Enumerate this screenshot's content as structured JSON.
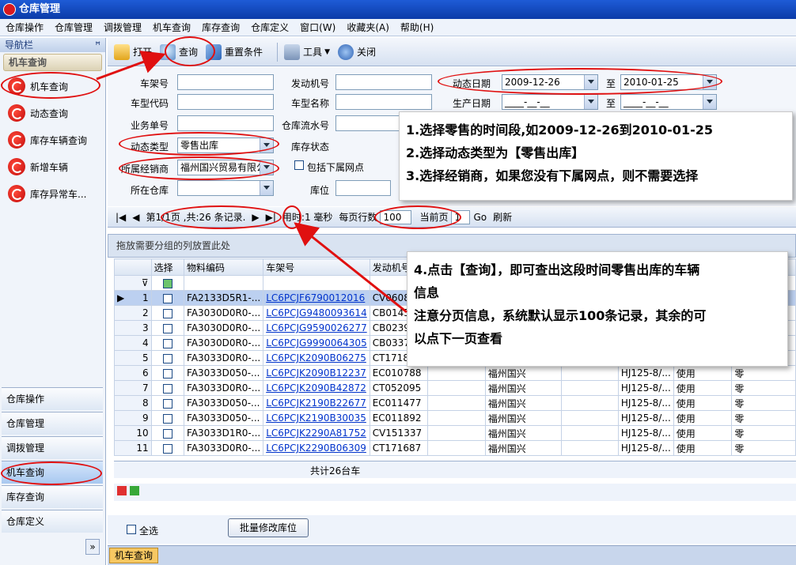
{
  "app": {
    "title": "仓库管理"
  },
  "menu": [
    "仓库操作",
    "仓库管理",
    "调拨管理",
    "机车查询",
    "库存查询",
    "仓库定义",
    "窗口(W)",
    "收藏夹(A)",
    "帮助(H)"
  ],
  "nav": {
    "header": "导航栏",
    "pin": "ꟸ",
    "group": "机车查询",
    "items": [
      "机车查询",
      "动态查询",
      "库存车辆查询",
      "新增车辆",
      "库存异常车..."
    ],
    "bottom": [
      "仓库操作",
      "仓库管理",
      "调拨管理",
      "机车查询",
      "库存查询",
      "仓库定义"
    ],
    "more": "»"
  },
  "toolbar": {
    "open": "打开",
    "query": "查询",
    "reset": "重置条件",
    "tools": "工具",
    "close": "关闭"
  },
  "form": {
    "frame_no": {
      "label": "车架号",
      "value": ""
    },
    "engine_no": {
      "label": "发动机号",
      "value": ""
    },
    "model_code": {
      "label": "车型代码",
      "value": ""
    },
    "model_name": {
      "label": "车型名称",
      "value": ""
    },
    "biz_no": {
      "label": "业务单号",
      "value": ""
    },
    "serial_no": {
      "label": "仓库流水号",
      "value": ""
    },
    "dyn_type": {
      "label": "动态类型",
      "value": "零售出库"
    },
    "stock_status": {
      "label": "库存状态"
    },
    "dealer": {
      "label": "所属经销商",
      "value": "福州国兴贸易有限公"
    },
    "include_sub": "包括下属网点",
    "warehouse": {
      "label": "所在仓库",
      "value": ""
    },
    "location": {
      "label": "库位",
      "value": ""
    },
    "dyn_date": {
      "label": "动态日期",
      "from": "2009-12-26",
      "to_label": "至",
      "to": "2010-01-25"
    },
    "prod_date": {
      "label": "生产日期",
      "from": "____-__-__",
      "to_label": "至",
      "to": "____-__-__"
    }
  },
  "pager": {
    "page_info": "第1/1页 ,共:26 条记录.",
    "time": "用时:1 毫秒",
    "rows_label": "每页行数",
    "rows": "100",
    "cur_label": "当前页",
    "cur": "1",
    "go": "Go",
    "refresh": "刷新"
  },
  "grid": {
    "group_hint": "拖放需要分组的列放置此处",
    "headers": [
      "选择",
      "物料编码",
      "车架号",
      "发动机号"
    ],
    "rows": [
      [
        "1",
        "FA2133D5R1-...",
        "LC6PCJF6790012016",
        "CV060834",
        "",
        "",
        "",
        "",
        "",
        ""
      ],
      [
        "2",
        "FA3030D0R0-...",
        "LC6PCJG9480093614",
        "CB014571",
        "",
        "",
        "",
        "",
        "",
        ""
      ],
      [
        "3",
        "FA3030D0R0-...",
        "LC6PCJG9590026277",
        "CB023963",
        "",
        "",
        "",
        "",
        "",
        ""
      ],
      [
        "4",
        "FA3030D0R0-...",
        "LC6PCJG9990064305",
        "CB033728",
        "",
        "",
        "",
        "",
        "",
        ""
      ],
      [
        "5",
        "FA3033D0R0-...",
        "LC6PCJK2090B06275",
        "CT171847",
        "",
        "",
        "",
        "",
        "",
        ""
      ],
      [
        "6",
        "FA3033D050-...",
        "LC6PCJK2090B12237",
        "EC010788",
        "",
        "福州国兴",
        "",
        "HJ125-8/...",
        "使用",
        "零"
      ],
      [
        "7",
        "FA3033D0R0-...",
        "LC6PCJK2090B42872",
        "CT052095",
        "",
        "福州国兴",
        "",
        "HJ125-8/...",
        "使用",
        "零"
      ],
      [
        "8",
        "FA3033D050-...",
        "LC6PCJK2190B22677",
        "EC011477",
        "",
        "福州国兴",
        "",
        "HJ125-8/...",
        "使用",
        "零"
      ],
      [
        "9",
        "FA3033D050-...",
        "LC6PCJK2190B30035",
        "EC011892",
        "",
        "福州国兴",
        "",
        "HJ125-8/...",
        "使用",
        "零"
      ],
      [
        "10",
        "FA3033D1R0-...",
        "LC6PCJK2290A81752",
        "CV151337",
        "",
        "福州国兴",
        "",
        "HJ125-8/...",
        "使用",
        "零"
      ],
      [
        "11",
        "FA3033D0R0-...",
        "LC6PCJK2290B06309",
        "CT171687",
        "",
        "福州国兴",
        "",
        "HJ125-8/...",
        "使用",
        "零"
      ]
    ],
    "summary": "共计26台车"
  },
  "bottom": {
    "select_all": "全选",
    "batch": "批量修改库位",
    "tab": "机车查询"
  },
  "callouts": {
    "c1": [
      "1.选择零售的时间段,如2009-12-26到2010-01-25",
      "2.选择动态类型为【零售出库】",
      "3.选择经销商，如果您没有下属网点，则不需要选择"
    ],
    "c2": [
      "4.点击【查询】，即可查出这段时间零售出库的车辆",
      "信息",
      "注意分页信息，系统默认显示100条记录，其余的可",
      "以点下一页查看"
    ]
  }
}
